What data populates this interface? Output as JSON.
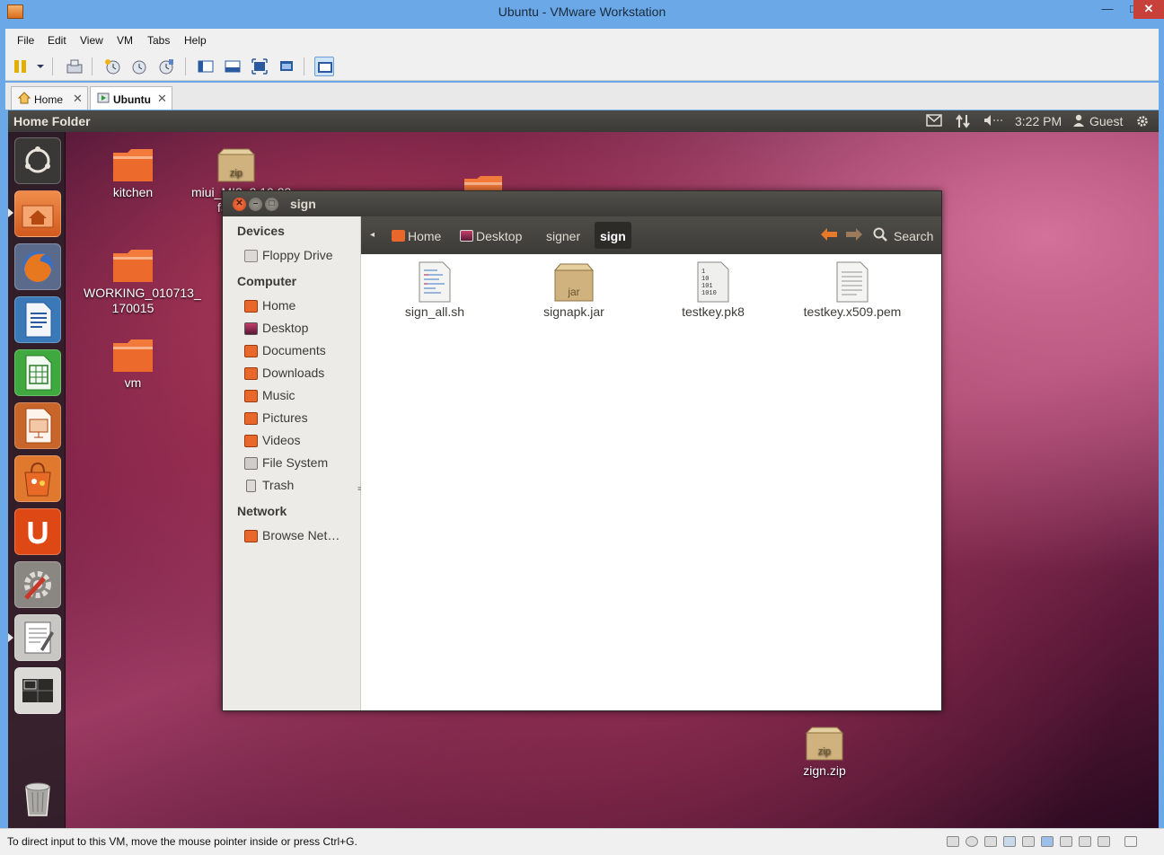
{
  "window": {
    "title": "Ubuntu - VMware Workstation",
    "controls": {
      "minimize": "—",
      "maximize": "□",
      "close": "✕"
    }
  },
  "menu": [
    "File",
    "Edit",
    "View",
    "VM",
    "Tabs",
    "Help"
  ],
  "tabs": [
    {
      "label": "Home",
      "active": false
    },
    {
      "label": "Ubuntu",
      "active": true
    }
  ],
  "ubuntu_panel": {
    "title": "Home Folder",
    "time": "3:22 PM",
    "user": "Guest"
  },
  "desktop_icons": [
    {
      "label": "kitchen",
      "type": "folder"
    },
    {
      "label": "miui_MI2_3.10.23_f33cd8",
      "type": "zip",
      "line1": "miui_MI2_3.10.23",
      "line2": "f33cd8"
    },
    {
      "label": "WORKING_010713_170015",
      "type": "folder",
      "line1": "WORKING_010713_",
      "line2": "170015"
    },
    {
      "label": "vm",
      "type": "folder"
    },
    {
      "label": "zign.zip",
      "type": "zip"
    }
  ],
  "file_manager": {
    "title": "sign",
    "sidebar": {
      "devices_header": "Devices",
      "devices": [
        "Floppy Drive"
      ],
      "computer_header": "Computer",
      "computer": [
        "Home",
        "Desktop",
        "Documents",
        "Downloads",
        "Music",
        "Pictures",
        "Videos",
        "File System",
        "Trash"
      ],
      "network_header": "Network",
      "network": [
        "Browse Net…"
      ]
    },
    "breadcrumbs": [
      "Home",
      "Desktop",
      "signer",
      "sign"
    ],
    "search_label": "Search",
    "files": [
      {
        "name": "sign_all.sh",
        "type": "script"
      },
      {
        "name": "signapk.jar",
        "type": "jar",
        "badge": "jar"
      },
      {
        "name": "testkey.pk8",
        "type": "binary",
        "badge_lines": [
          "1",
          "10",
          "101",
          "1010"
        ]
      },
      {
        "name": "testkey.x509.pem",
        "type": "text"
      }
    ]
  },
  "zip_badge": "zip",
  "statusbar": {
    "hint": "To direct input to this VM, move the mouse pointer inside or press Ctrl+G."
  },
  "colors": {
    "folder_orange": "#e8622a",
    "ubuntu_panel": "#3c3b37",
    "vmware_frame": "#6aa8e8",
    "close_red": "#df4a16"
  }
}
